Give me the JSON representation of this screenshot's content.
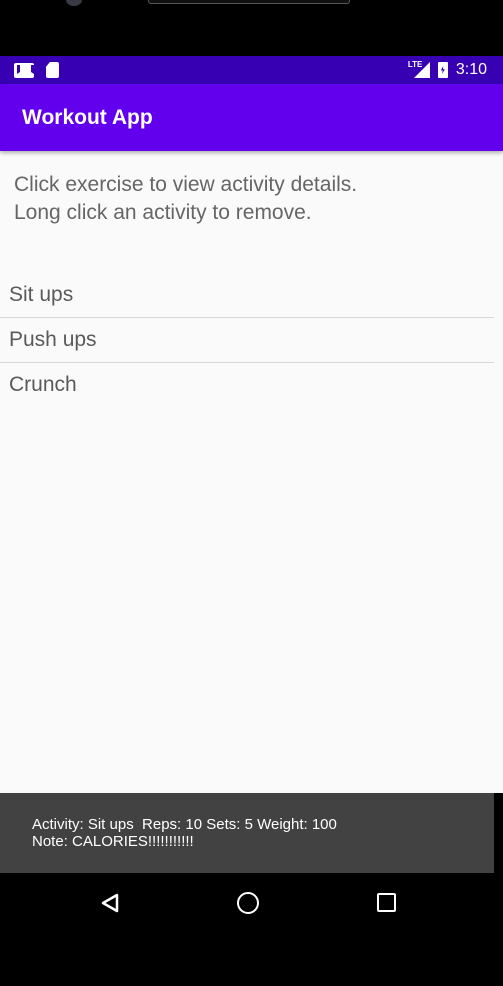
{
  "status_bar": {
    "time": "3:10",
    "network_label": "LTE",
    "left_icons": [
      "gmail-icon",
      "sd-card-icon"
    ],
    "right_icons": [
      "lte-signal-icon",
      "battery-charging-icon"
    ],
    "background": "#3700b3"
  },
  "app_bar": {
    "title": "Workout App",
    "background": "#6200ee"
  },
  "instructions": {
    "line1": "Click exercise to view activity details.",
    "line2": "Long click an activity to remove."
  },
  "exercises": [
    {
      "label": "Sit ups"
    },
    {
      "label": "Push ups"
    },
    {
      "label": "Crunch"
    }
  ],
  "toast": {
    "line1": "Activity: Sit ups  Reps: 10 Sets: 5 Weight: 100",
    "line2": "Note: CALORIES!!!!!!!!!!!",
    "background": "#424242"
  },
  "nav_bar": {
    "icons": [
      "back-icon",
      "home-icon",
      "recents-icon"
    ]
  }
}
